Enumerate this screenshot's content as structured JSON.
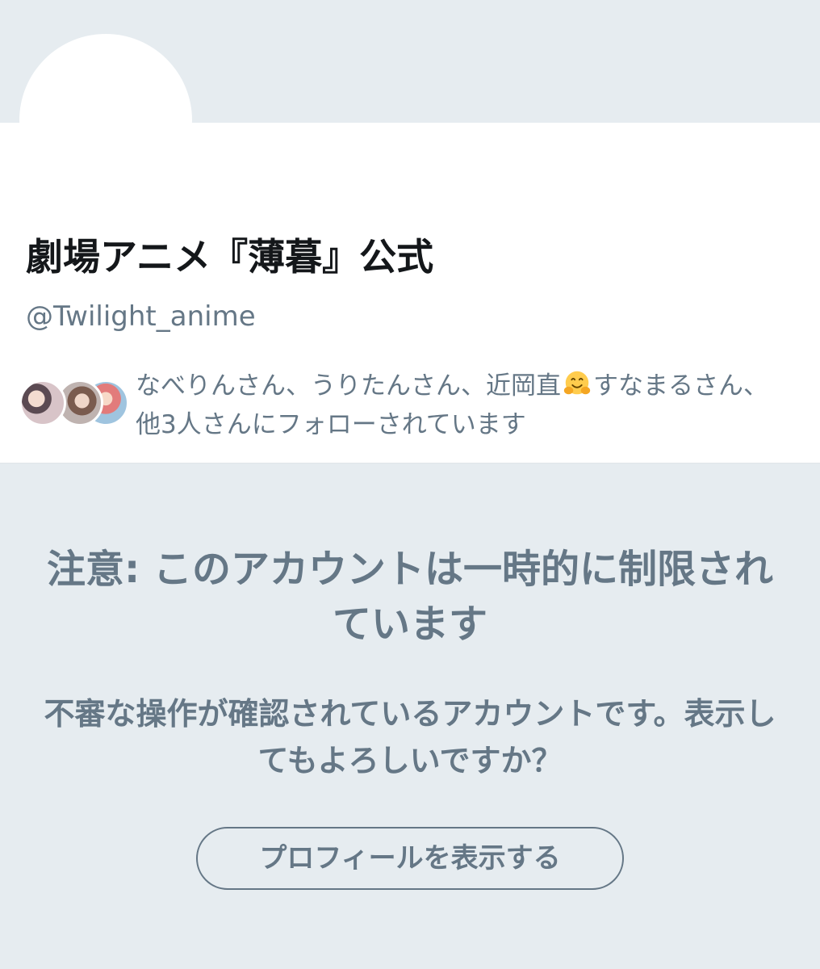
{
  "profile": {
    "display_name": "劇場アニメ『薄暮』公式",
    "handle": "@Twilight_anime",
    "followed_by": {
      "text_before_emoji": "なべりんさん、うりたんさん、近岡直",
      "emoji": "hugging-face-emoji",
      "text_after_emoji": "すなまるさん、他3人さんにフォローされています",
      "avatars": [
        "follower-avatar-1",
        "follower-avatar-2",
        "follower-avatar-3"
      ]
    }
  },
  "notice": {
    "title": "注意: このアカウントは一時的に制限されています",
    "body": "不審な操作が確認されているアカウントです。表示してもよろしいですか？",
    "button_label": "プロフィールを表示する"
  },
  "colors": {
    "background": "#e6ecf0",
    "card": "#ffffff",
    "name_text": "#14171a",
    "secondary_text": "#657786"
  }
}
